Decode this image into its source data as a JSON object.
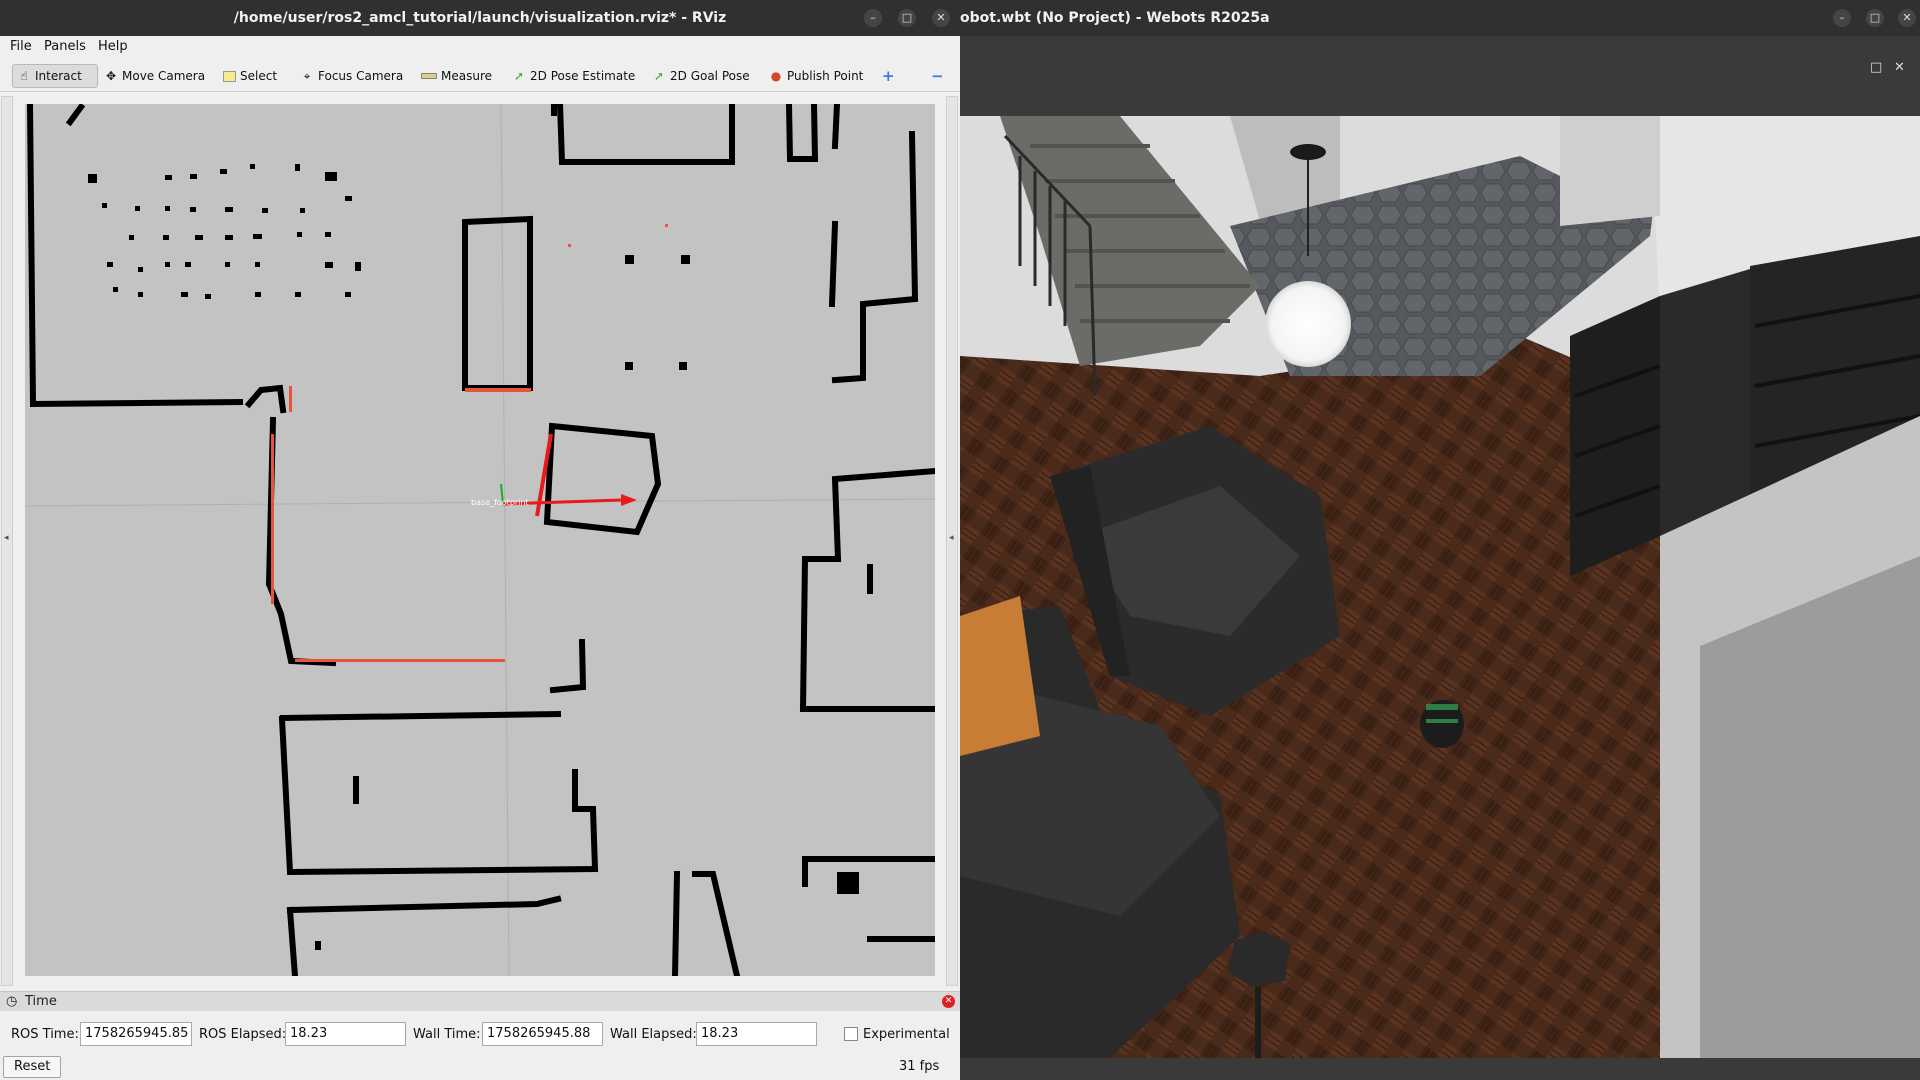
{
  "rviz": {
    "title": "/home/user/ros2_amcl_tutorial/launch/visualization.rviz* - RViz",
    "window_controls": {
      "minimize": "–",
      "maximize": "□",
      "close": "✕"
    },
    "menu": [
      "File",
      "Panels",
      "Help"
    ],
    "toolbar": {
      "interact": "Interact",
      "move_camera": "Move Camera",
      "select": "Select",
      "focus_camera": "Focus Camera",
      "measure": "Measure",
      "pose_estimate": "2D Pose Estimate",
      "goal_pose": "2D Goal Pose",
      "publish_point": "Publish Point",
      "add_icon": "+",
      "remove_icon": "−"
    },
    "map": {
      "robot_frame_label": "base_footprint",
      "colors": {
        "background": "#c3c3c3",
        "wall": "#000000",
        "laser": "#e8533c",
        "x_axis": "#e81b1b",
        "y_axis": "#1bb21b"
      }
    },
    "time_panel": {
      "title": "Time",
      "ros_time_label": "ROS Time:",
      "ros_time": "1758265945.85",
      "ros_elapsed_label": "ROS Elapsed:",
      "ros_elapsed": "18.23",
      "wall_time_label": "Wall Time:",
      "wall_time": "1758265945.88",
      "wall_elapsed_label": "Wall Elapsed:",
      "wall_elapsed": "18.23",
      "experimental_label": "Experimental",
      "experimental_checked": false,
      "reset_label": "Reset",
      "fps": "31 fps"
    }
  },
  "webots": {
    "title": "obot.wbt (No Project) - Webots R2025a",
    "window_controls": {
      "minimize": "–",
      "maximize": "□",
      "close": "✕"
    },
    "view_controls": {
      "maximize": "□",
      "close": "✕"
    }
  }
}
